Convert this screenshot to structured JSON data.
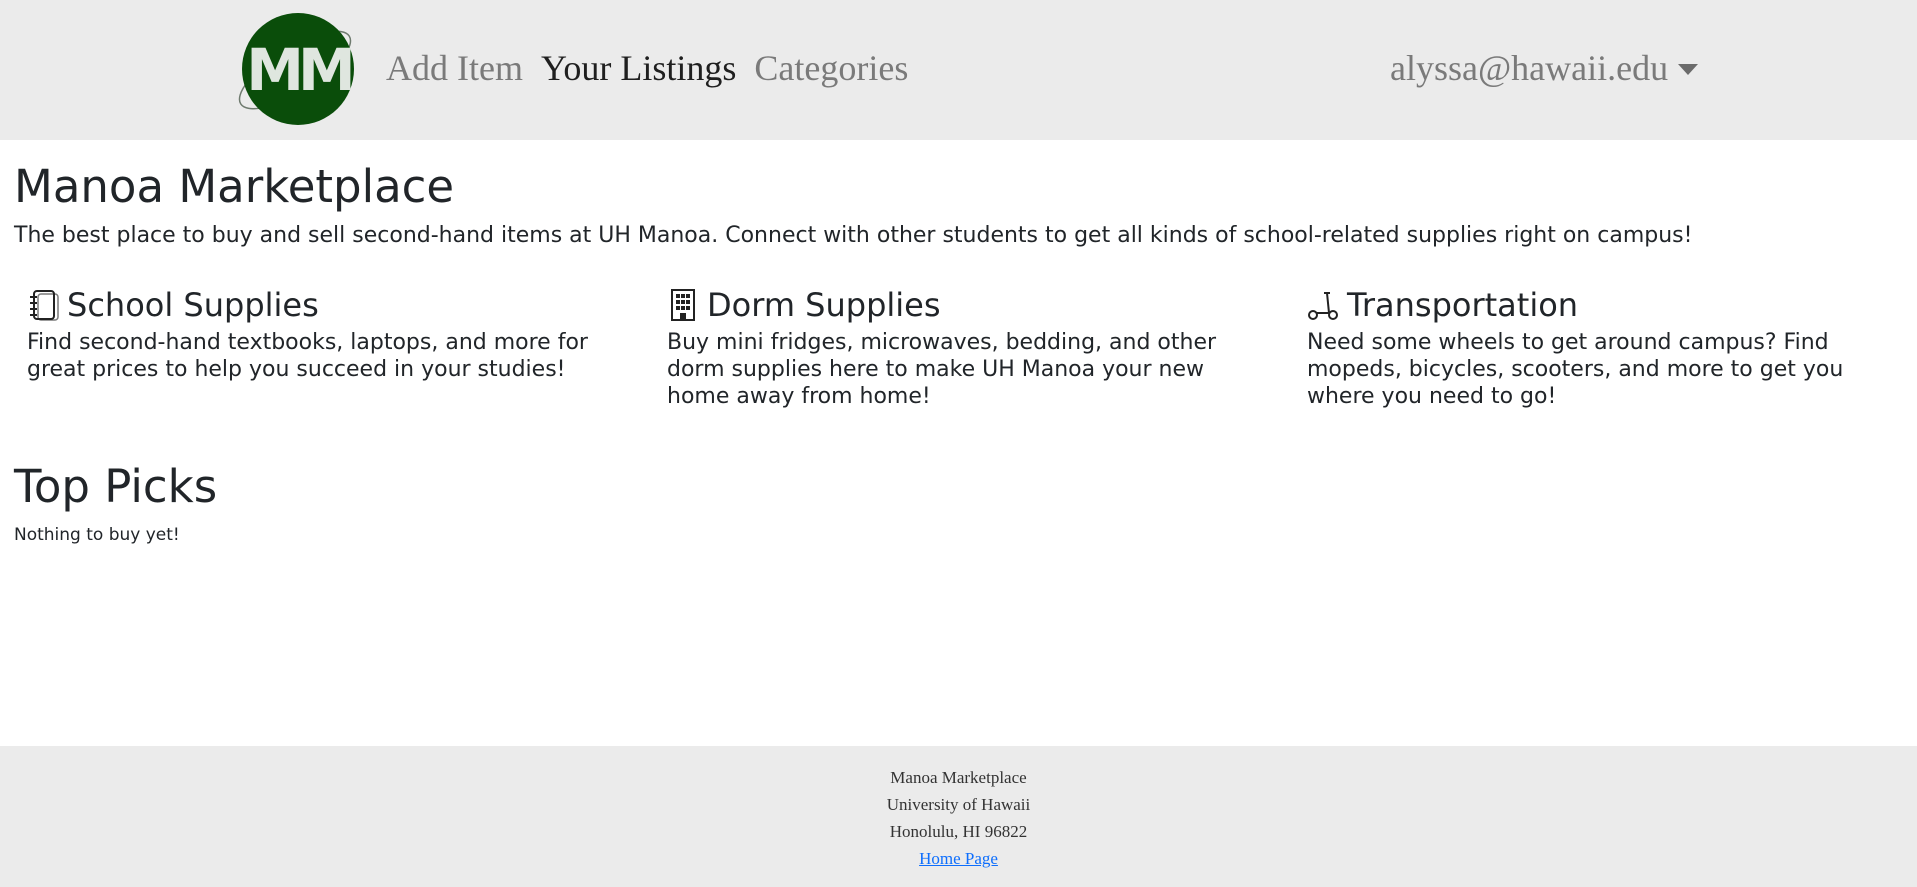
{
  "navbar": {
    "logo_text": "MM",
    "links": [
      {
        "label": "Add Item",
        "active": false
      },
      {
        "label": "Your Listings",
        "active": true
      },
      {
        "label": "Categories",
        "active": false
      }
    ],
    "user_email": "alyssa@hawaii.edu"
  },
  "main": {
    "title": "Manoa Marketplace",
    "subtitle": "The best place to buy and sell second-hand items at UH Manoa. Connect with other students to get all kinds of school-related supplies right on campus!",
    "features": [
      {
        "icon": "notebook-icon",
        "title": "School Supplies",
        "text": "Find second-hand textbooks, laptops, and more for great prices to help you succeed in your studies!"
      },
      {
        "icon": "building-icon",
        "title": "Dorm Supplies",
        "text": "Buy mini fridges, microwaves, bedding, and other dorm supplies here to make UH Manoa your new home away from home!"
      },
      {
        "icon": "scooter-icon",
        "title": "Transportation",
        "text": "Need some wheels to get around campus? Find mopeds, bicycles, scooters, and more to get you where you need to go!"
      }
    ],
    "top_picks_title": "Top Picks",
    "empty_message": "Nothing to buy yet!"
  },
  "footer": {
    "line1": "Manoa Marketplace",
    "line2": "University of Hawaii",
    "line3": "Honolulu, HI 96822",
    "link": "Home Page"
  },
  "colors": {
    "navbar_bg": "#ebebeb",
    "logo_green": "#0a4d0a",
    "link": "#0d6efd"
  }
}
